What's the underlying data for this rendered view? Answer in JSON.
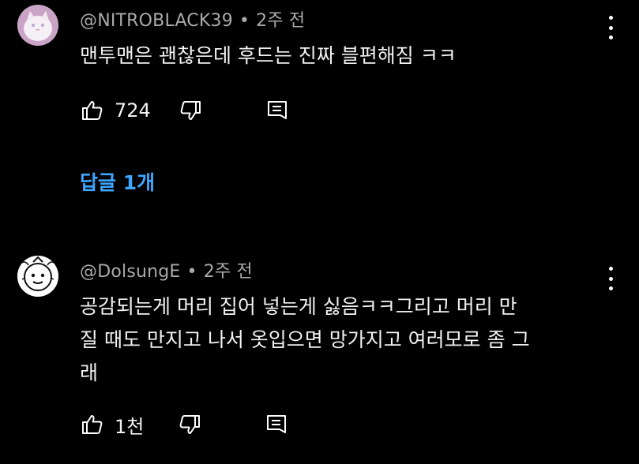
{
  "comments": [
    {
      "author": "@NITROBLACK39",
      "time": "2주 전",
      "text": "맨투맨은 괜찮은데 후드는 진짜 블편해짐 ㅋㅋ",
      "likes": "724",
      "replies": "답글 1개"
    },
    {
      "author": "@DolsungE",
      "time": "2주 전",
      "text_lines": [
        "공감되는게 머리 집어 넣는게 싫음ㅋㅋ그리고 머리 만",
        "질 때도 만지고 나서 옷입으면 망가지고 여러모로 좀 그",
        "래"
      ],
      "likes": "1천"
    }
  ],
  "meta_separator": "•",
  "icons": [
    "like-icon",
    "dislike-icon",
    "reply-icon",
    "more-options-icon"
  ]
}
